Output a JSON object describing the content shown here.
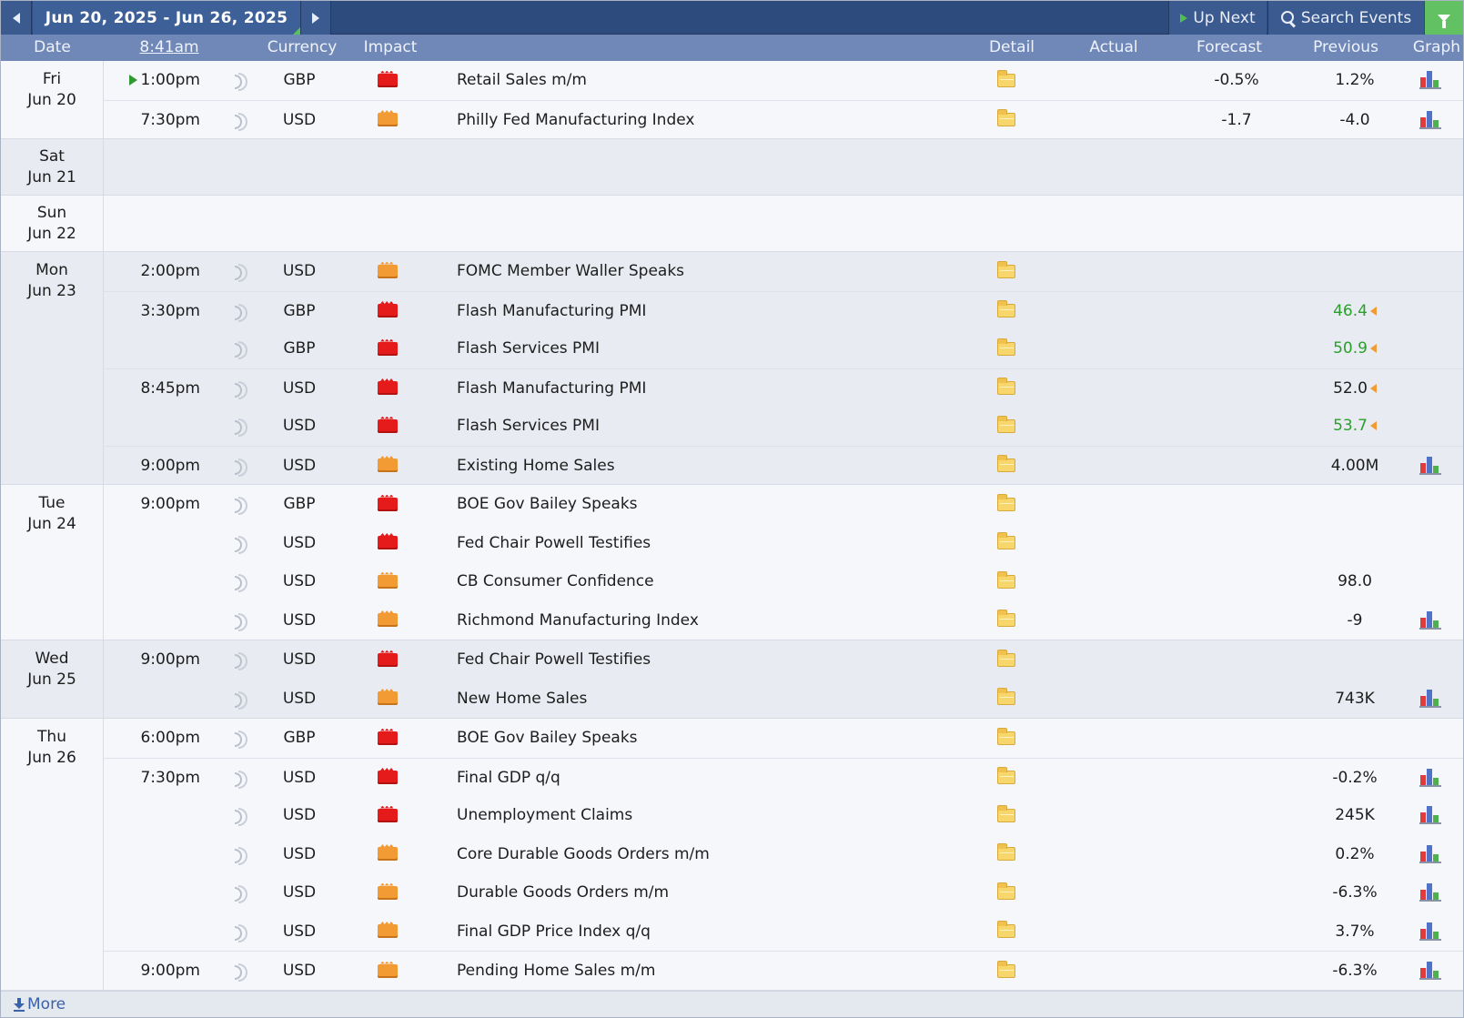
{
  "toolbar": {
    "range_label": "Jun 20, 2025 - Jun 26, 2025",
    "up_next_label": "Up Next",
    "search_label": "Search Events"
  },
  "columns": {
    "date": "Date",
    "time": "8:41am",
    "currency": "Currency",
    "impact": "Impact",
    "detail": "Detail",
    "actual": "Actual",
    "forecast": "Forecast",
    "previous": "Previous",
    "graph": "Graph"
  },
  "colors": {
    "topbar": "#2e4b7e",
    "header": "#7088b8",
    "high_impact": "#e51b1b",
    "medium_impact": "#f29a34",
    "better_than_expected": "#2b9f2b"
  },
  "days": [
    {
      "day": "Fri",
      "date": "Jun 20",
      "events": [
        {
          "time": "1:00pm",
          "current": true,
          "currency": "GBP",
          "impact": "high",
          "title": "Retail Sales m/m",
          "forecast": "-0.5%",
          "previous": "1.2%",
          "graph": true,
          "sep": false
        },
        {
          "time": "7:30pm",
          "currency": "USD",
          "impact": "med",
          "title": "Philly Fed Manufacturing Index",
          "forecast": "-1.7",
          "previous": "-4.0",
          "graph": true,
          "sep": true
        }
      ]
    },
    {
      "day": "Sat",
      "date": "Jun 21",
      "events": []
    },
    {
      "day": "Sun",
      "date": "Jun 22",
      "events": []
    },
    {
      "day": "Mon",
      "date": "Jun 23",
      "events": [
        {
          "time": "2:00pm",
          "currency": "USD",
          "impact": "med",
          "title": "FOMC Member Waller Speaks",
          "forecast": "",
          "previous": "",
          "graph": false,
          "sep": false
        },
        {
          "time": "3:30pm",
          "currency": "GBP",
          "impact": "high",
          "title": "Flash Manufacturing PMI",
          "forecast": "",
          "previous": "46.4",
          "revised": true,
          "graph": false,
          "sep": true
        },
        {
          "time": "",
          "currency": "GBP",
          "impact": "high",
          "title": "Flash Services PMI",
          "forecast": "",
          "previous": "50.9",
          "revised": true,
          "graph": false,
          "sep": false
        },
        {
          "time": "8:45pm",
          "currency": "USD",
          "impact": "high",
          "title": "Flash Manufacturing PMI",
          "forecast": "",
          "previous": "52.0",
          "revised": true,
          "revised_dark": true,
          "graph": false,
          "sep": true
        },
        {
          "time": "",
          "currency": "USD",
          "impact": "high",
          "title": "Flash Services PMI",
          "forecast": "",
          "previous": "53.7",
          "revised": true,
          "graph": false,
          "sep": false
        },
        {
          "time": "9:00pm",
          "currency": "USD",
          "impact": "med",
          "title": "Existing Home Sales",
          "forecast": "",
          "previous": "4.00M",
          "graph": true,
          "sep": true
        }
      ]
    },
    {
      "day": "Tue",
      "date": "Jun 24",
      "events": [
        {
          "time": "9:00pm",
          "currency": "GBP",
          "impact": "high",
          "title": "BOE Gov Bailey Speaks",
          "forecast": "",
          "previous": "",
          "graph": false,
          "sep": false
        },
        {
          "time": "",
          "currency": "USD",
          "impact": "high",
          "title": "Fed Chair Powell Testifies",
          "forecast": "",
          "previous": "",
          "graph": false,
          "sep": false
        },
        {
          "time": "",
          "currency": "USD",
          "impact": "med",
          "title": "CB Consumer Confidence",
          "forecast": "",
          "previous": "98.0",
          "graph": false,
          "sep": false
        },
        {
          "time": "",
          "currency": "USD",
          "impact": "med",
          "title": "Richmond Manufacturing Index",
          "forecast": "",
          "previous": "-9",
          "graph": true,
          "sep": false
        }
      ]
    },
    {
      "day": "Wed",
      "date": "Jun 25",
      "events": [
        {
          "time": "9:00pm",
          "currency": "USD",
          "impact": "high",
          "title": "Fed Chair Powell Testifies",
          "forecast": "",
          "previous": "",
          "graph": false,
          "sep": false
        },
        {
          "time": "",
          "currency": "USD",
          "impact": "med",
          "title": "New Home Sales",
          "forecast": "",
          "previous": "743K",
          "graph": true,
          "sep": false
        }
      ]
    },
    {
      "day": "Thu",
      "date": "Jun 26",
      "events": [
        {
          "time": "6:00pm",
          "currency": "GBP",
          "impact": "high",
          "title": "BOE Gov Bailey Speaks",
          "forecast": "",
          "previous": "",
          "graph": false,
          "sep": false
        },
        {
          "time": "7:30pm",
          "currency": "USD",
          "impact": "high",
          "title": "Final GDP q/q",
          "forecast": "",
          "previous": "-0.2%",
          "graph": true,
          "sep": true
        },
        {
          "time": "",
          "currency": "USD",
          "impact": "high",
          "title": "Unemployment Claims",
          "forecast": "",
          "previous": "245K",
          "graph": true,
          "sep": false
        },
        {
          "time": "",
          "currency": "USD",
          "impact": "med",
          "title": "Core Durable Goods Orders m/m",
          "forecast": "",
          "previous": "0.2%",
          "graph": true,
          "sep": false
        },
        {
          "time": "",
          "currency": "USD",
          "impact": "med",
          "title": "Durable Goods Orders m/m",
          "forecast": "",
          "previous": "-6.3%",
          "graph": true,
          "sep": false
        },
        {
          "time": "",
          "currency": "USD",
          "impact": "med",
          "title": "Final GDP Price Index q/q",
          "forecast": "",
          "previous": "3.7%",
          "graph": true,
          "sep": false
        },
        {
          "time": "9:00pm",
          "currency": "USD",
          "impact": "med",
          "title": "Pending Home Sales m/m",
          "forecast": "",
          "previous": "-6.3%",
          "graph": true,
          "sep": true
        }
      ]
    }
  ],
  "footer": {
    "more_label": "More"
  }
}
